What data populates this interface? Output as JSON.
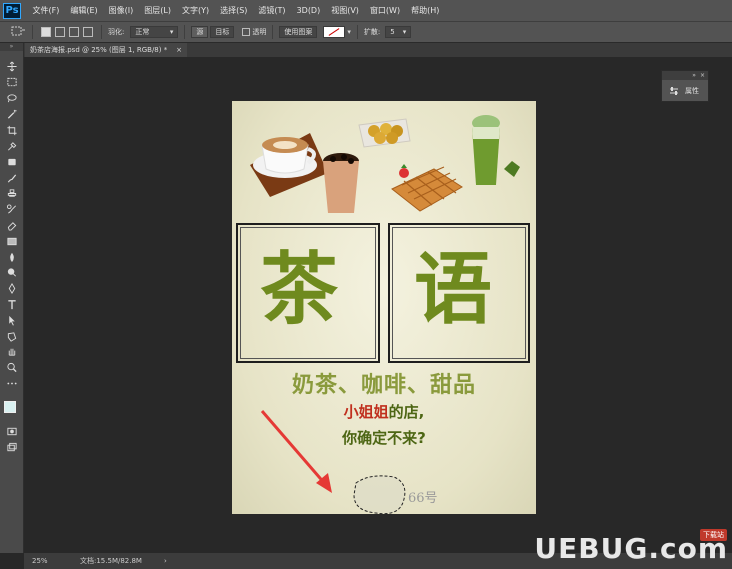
{
  "app": {
    "logo": "Ps",
    "menu": [
      "文件(F)",
      "编辑(E)",
      "图像(I)",
      "图层(L)",
      "文字(Y)",
      "选择(S)",
      "滤镜(T)",
      "3D(D)",
      "视图(V)",
      "窗口(W)",
      "帮助(H)"
    ]
  },
  "options": {
    "feather_label": "羽化:",
    "mode_value": "正常",
    "source_label": "源",
    "target_label": "目标",
    "transparent_label": "透明",
    "use_pattern_label": "使用图案",
    "diffusion_label": "扩散:",
    "diffusion_value": "5"
  },
  "document": {
    "tab_title": "奶茶店海报.psd @ 25% (图层 1, RGB/8) *",
    "close": "×"
  },
  "properties_panel": {
    "label": "属性",
    "collapse": "»",
    "close": "×"
  },
  "status": {
    "zoom": "25%",
    "doc_info": "文档:15.5M/82.8M",
    "arrow": "›"
  },
  "poster": {
    "char_left": "茶",
    "char_right": "语",
    "line1": "奶茶、咖啡、甜品",
    "line2_a": "小姐姐",
    "line2_b": "的店,",
    "line3": "你确定不来?",
    "number": "66号"
  },
  "watermark": {
    "brand": "UEBUG.com",
    "tag": "下载站"
  },
  "colors": {
    "accent_red": "#e53935",
    "olive": "#6f8a1e"
  }
}
